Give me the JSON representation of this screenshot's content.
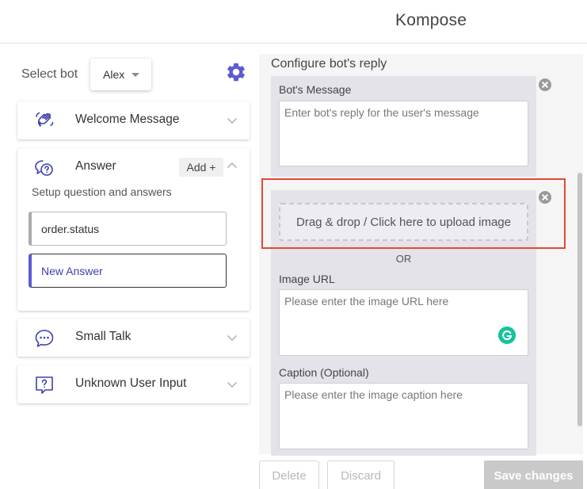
{
  "app": {
    "title": "Kompose"
  },
  "bot_selector": {
    "label": "Select bot",
    "selected": "Alex"
  },
  "sections": {
    "welcome": {
      "title": "Welcome Message",
      "icon": "wave-hand-icon"
    },
    "answer": {
      "title": "Answer",
      "add_label": "Add +",
      "setup_text": "Setup question and answers",
      "items": [
        {
          "label": "order.status"
        },
        {
          "label": "New Answer"
        }
      ],
      "icon": "question-chat-icon"
    },
    "small_talk": {
      "title": "Small Talk",
      "icon": "chat-bubble-icon"
    },
    "unknown": {
      "title": "Unknown User Input",
      "icon": "question-box-icon"
    }
  },
  "config": {
    "title": "Configure bot's reply",
    "message": {
      "label": "Bot's Message",
      "placeholder": "Enter bot's reply for the user's message"
    },
    "image": {
      "upload_text": "Drag & drop / Click here to upload image",
      "or_text": "OR",
      "url_label": "Image URL",
      "url_placeholder": "Please enter the image URL here",
      "caption_label": "Caption (Optional)",
      "caption_placeholder": "Please enter the image caption here"
    }
  },
  "footer": {
    "delete_label": "Delete",
    "discard_label": "Discard",
    "save_label": "Save changes"
  },
  "colors": {
    "accent": "#5b5bd6",
    "highlight": "#e04a35",
    "grammarly": "#15c39a"
  }
}
